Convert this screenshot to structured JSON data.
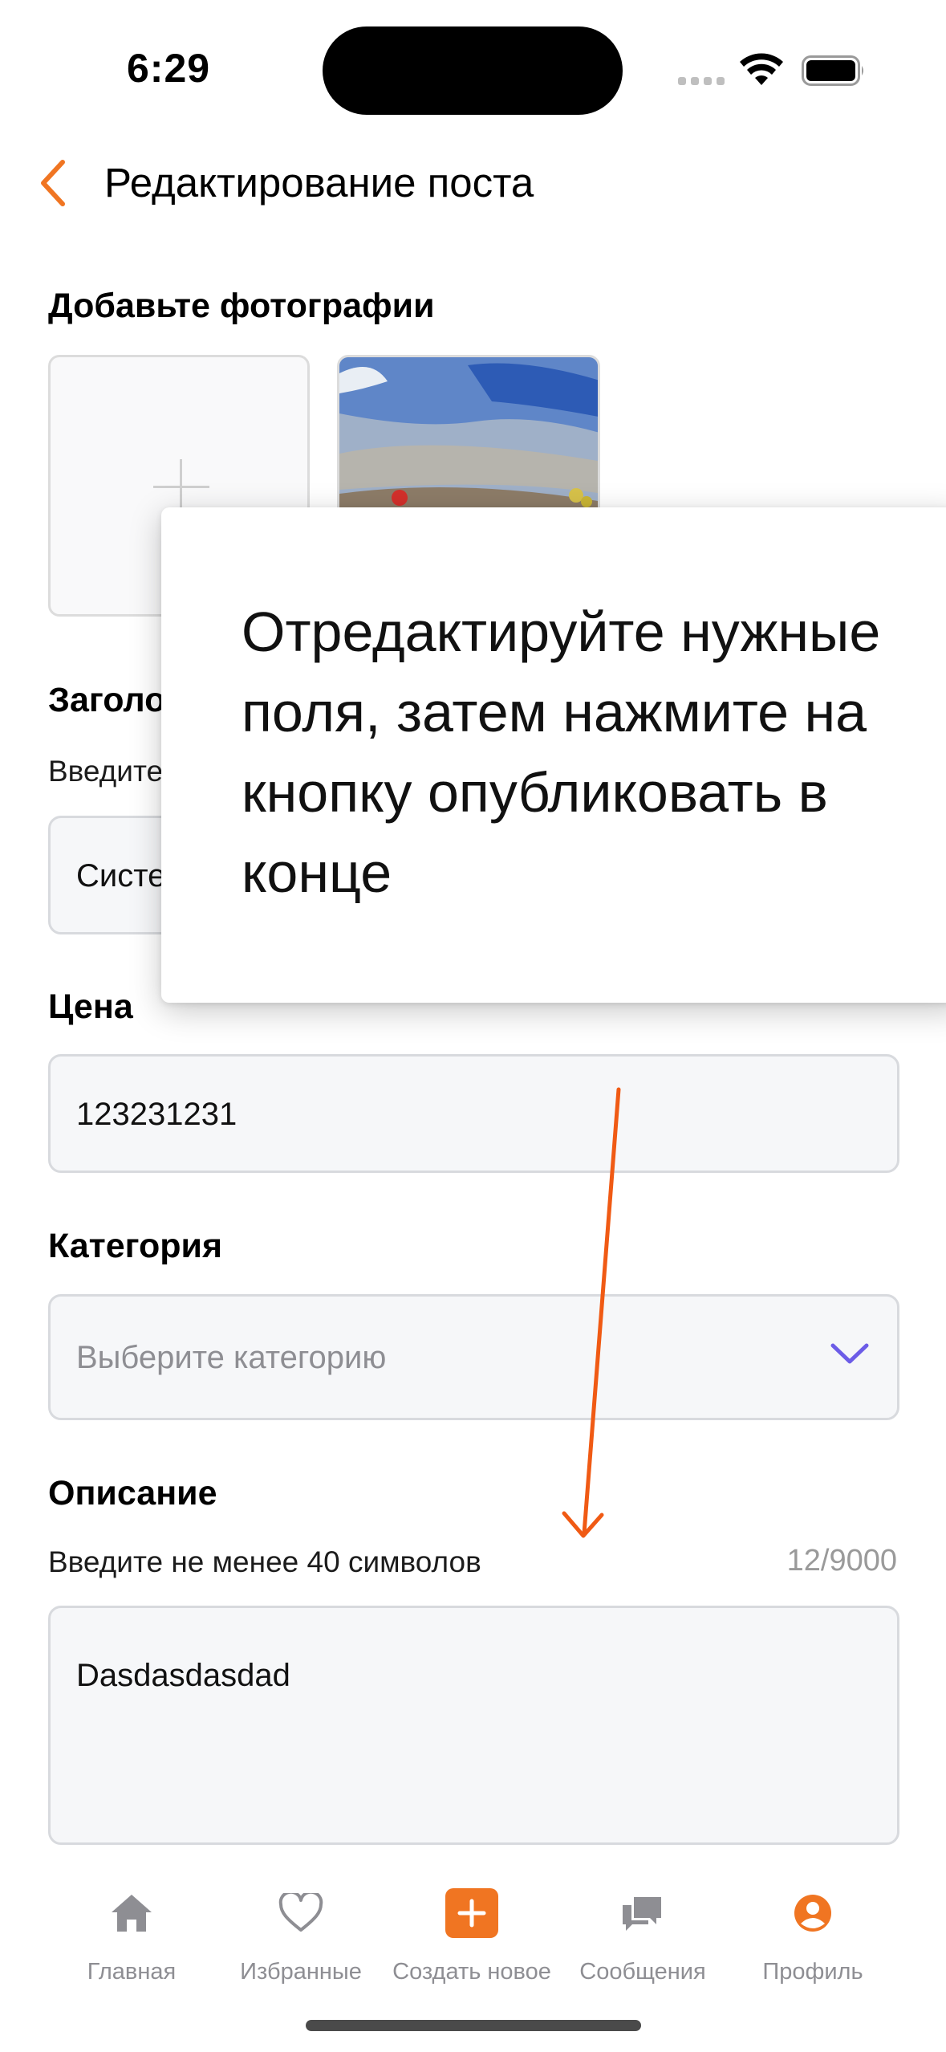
{
  "status_bar": {
    "time": "6:29"
  },
  "header": {
    "title": "Редактирование поста"
  },
  "photos": {
    "section_title": "Добавьте фотографии"
  },
  "title_field": {
    "section_title": "Заголовок",
    "hint": "Введите",
    "value": "Систе"
  },
  "price_field": {
    "section_title": "Цена",
    "value": "123231231"
  },
  "category_field": {
    "section_title": "Категория",
    "placeholder": "Выберите категорию"
  },
  "description_field": {
    "section_title": "Описание",
    "hint": "Введите не менее 40 символов",
    "counter": "12/9000",
    "value": "Dasdasdasdad"
  },
  "tooltip": {
    "text": "Отредактируйте нужные поля, затем нажмите на кнопку опубликовать в конце"
  },
  "tabbar": {
    "items": [
      {
        "label": "Главная",
        "icon": "home-icon"
      },
      {
        "label": "Избранные",
        "icon": "heart-icon"
      },
      {
        "label": "Создать новое",
        "icon": "plus-square-icon"
      },
      {
        "label": "Сообщения",
        "icon": "chat-icon"
      },
      {
        "label": "Профиль",
        "icon": "profile-icon"
      }
    ]
  },
  "colors": {
    "accent": "#F07522",
    "chevron": "#6C5CE7",
    "arrow": "#F05A14"
  }
}
